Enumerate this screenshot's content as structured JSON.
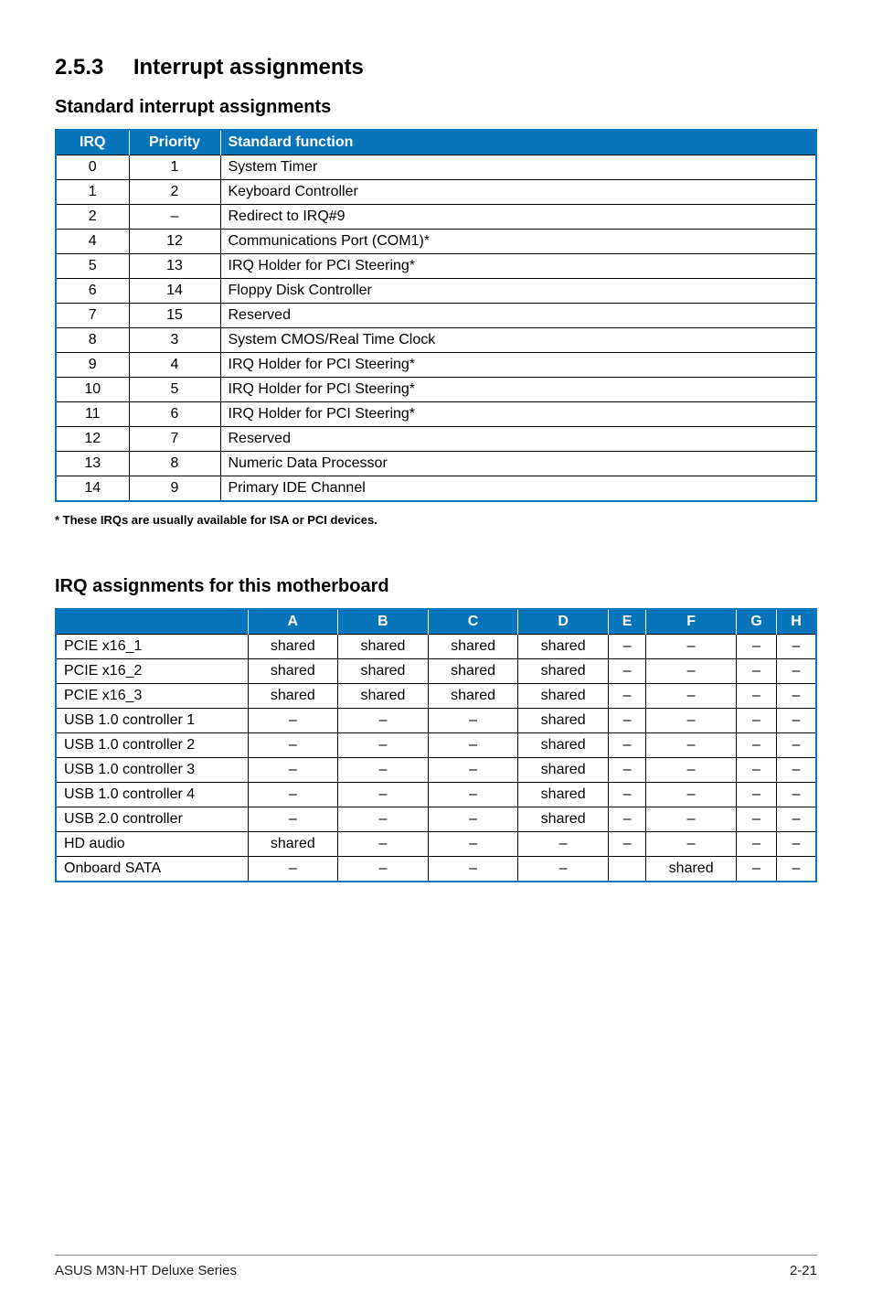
{
  "section": {
    "number": "2.5.3",
    "title": "Interrupt assignments"
  },
  "sub1": "Standard interrupt assignments",
  "t1": {
    "headers": {
      "irq": "IRQ",
      "priority": "Priority",
      "func": "Standard function"
    },
    "rows": [
      {
        "irq": "0",
        "priority": "1",
        "func": "System Timer"
      },
      {
        "irq": "1",
        "priority": "2",
        "func": "Keyboard Controller"
      },
      {
        "irq": "2",
        "priority": "–",
        "func": "Redirect to IRQ#9"
      },
      {
        "irq": "4",
        "priority": "12",
        "func": "Communications Port (COM1)*"
      },
      {
        "irq": "5",
        "priority": "13",
        "func": "IRQ Holder for PCI Steering*"
      },
      {
        "irq": "6",
        "priority": "14",
        "func": "Floppy Disk Controller"
      },
      {
        "irq": "7",
        "priority": "15",
        "func": "Reserved"
      },
      {
        "irq": "8",
        "priority": "3",
        "func": "System CMOS/Real Time Clock"
      },
      {
        "irq": "9",
        "priority": "4",
        "func": "IRQ Holder for PCI Steering*"
      },
      {
        "irq": "10",
        "priority": "5",
        "func": "IRQ Holder for PCI Steering*"
      },
      {
        "irq": "11",
        "priority": "6",
        "func": "IRQ Holder for PCI Steering*"
      },
      {
        "irq": "12",
        "priority": "7",
        "func": "Reserved"
      },
      {
        "irq": "13",
        "priority": "8",
        "func": "Numeric Data Processor"
      },
      {
        "irq": "14",
        "priority": "9",
        "func": "Primary IDE Channel"
      }
    ]
  },
  "footnote": "* These IRQs are usually available for ISA or PCI devices.",
  "sub2": "IRQ assignments for this motherboard",
  "t2": {
    "headers": [
      "",
      "A",
      "B",
      "C",
      "D",
      "E",
      "F",
      "G",
      "H"
    ],
    "rows": [
      {
        "name": "PCIE x16_1",
        "cells": [
          "shared",
          "shared",
          "shared",
          "shared",
          "–",
          "–",
          "–",
          "–"
        ]
      },
      {
        "name": "PCIE x16_2",
        "cells": [
          "shared",
          "shared",
          "shared",
          "shared",
          "–",
          "–",
          "–",
          "–"
        ]
      },
      {
        "name": "PCIE x16_3",
        "cells": [
          "shared",
          "shared",
          "shared",
          "shared",
          "–",
          "–",
          "–",
          "–"
        ]
      },
      {
        "name": "USB 1.0 controller 1",
        "cells": [
          "–",
          "–",
          "–",
          "shared",
          "–",
          "–",
          "–",
          "–"
        ]
      },
      {
        "name": "USB 1.0 controller 2",
        "cells": [
          "–",
          "–",
          "–",
          "shared",
          "–",
          "–",
          "–",
          "–"
        ]
      },
      {
        "name": "USB 1.0 controller 3",
        "cells": [
          "–",
          "–",
          "–",
          "shared",
          "–",
          "–",
          "–",
          "–"
        ]
      },
      {
        "name": "USB 1.0 controller 4",
        "cells": [
          "–",
          "–",
          "–",
          "shared",
          "–",
          "–",
          "–",
          "–"
        ]
      },
      {
        "name": "USB 2.0 controller",
        "cells": [
          "–",
          "–",
          "–",
          "shared",
          "–",
          "–",
          "–",
          "–"
        ]
      },
      {
        "name": "HD audio",
        "cells": [
          "shared",
          "–",
          "–",
          "–",
          "–",
          "–",
          "–",
          "–"
        ]
      },
      {
        "name": "Onboard SATA",
        "cells": [
          "–",
          "–",
          "–",
          "–",
          "",
          "shared",
          "–",
          "–"
        ]
      }
    ]
  },
  "footer": {
    "left": "ASUS M3N-HT Deluxe Series",
    "right": "2-21"
  }
}
